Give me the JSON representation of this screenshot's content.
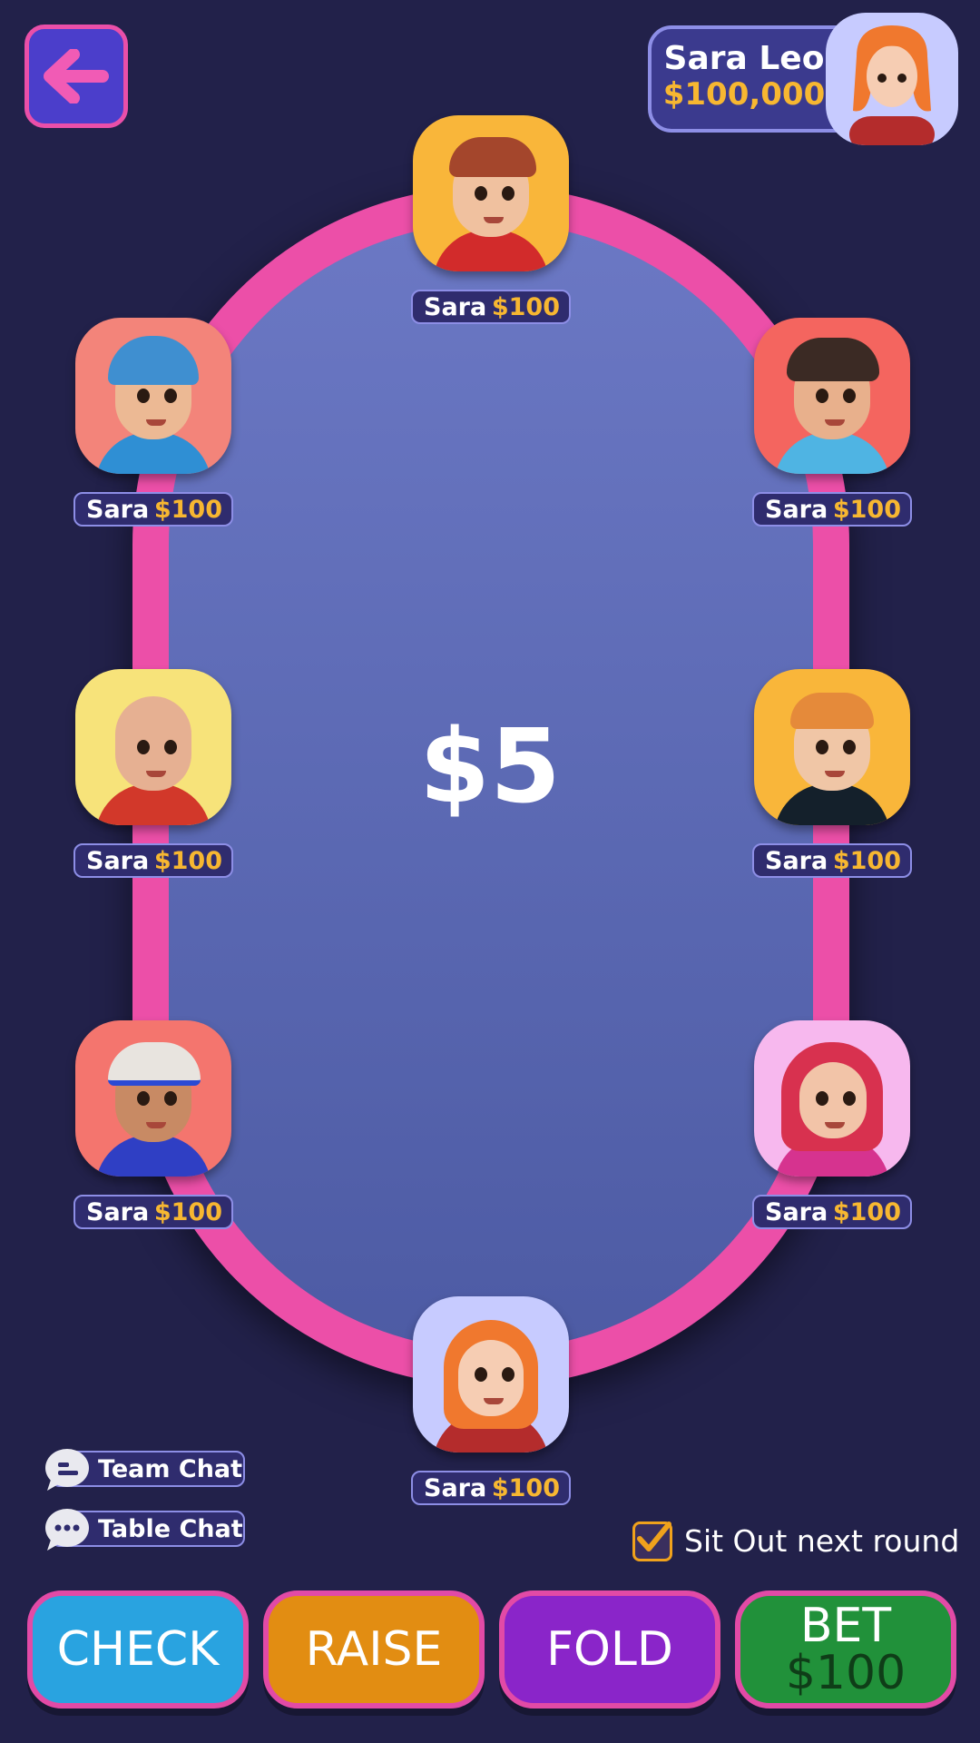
{
  "header": {
    "back_icon": "arrow-left-icon"
  },
  "player": {
    "name": "Sara Leo",
    "balance": "$100,000",
    "avatar_bg": "#c7cbff"
  },
  "table": {
    "pot": "$5",
    "rim_color": "#ec4fa8",
    "felt_color": "#5a68b4"
  },
  "seats": [
    {
      "name": "Sara",
      "amount": "$100",
      "bg": "#f9b63a"
    },
    {
      "name": "Sara",
      "amount": "$100",
      "bg": "#f3847a"
    },
    {
      "name": "Sara",
      "amount": "$100",
      "bg": "#f4655f"
    },
    {
      "name": "Sara",
      "amount": "$100",
      "bg": "#f7e37a"
    },
    {
      "name": "Sara",
      "amount": "$100",
      "bg": "#f9b63a"
    },
    {
      "name": "Sara",
      "amount": "$100",
      "bg": "#f4756e"
    },
    {
      "name": "Sara",
      "amount": "$100",
      "bg": "#f7b8ee"
    },
    {
      "name": "Sara",
      "amount": "$100",
      "bg": "#c7cbff"
    }
  ],
  "chat": {
    "team": "Team Chat",
    "table": "Table Chat"
  },
  "sit_out": {
    "label": "Sit Out next round",
    "checked": true
  },
  "actions": {
    "check": "CHECK",
    "raise": "RAISE",
    "fold": "FOLD",
    "bet": "BET",
    "bet_amount": "$100"
  },
  "colors": {
    "check": "#29a3e0",
    "raise": "#e28d12",
    "fold": "#8a25c9",
    "bet": "#21913a",
    "accent_gold": "#f7b731"
  }
}
